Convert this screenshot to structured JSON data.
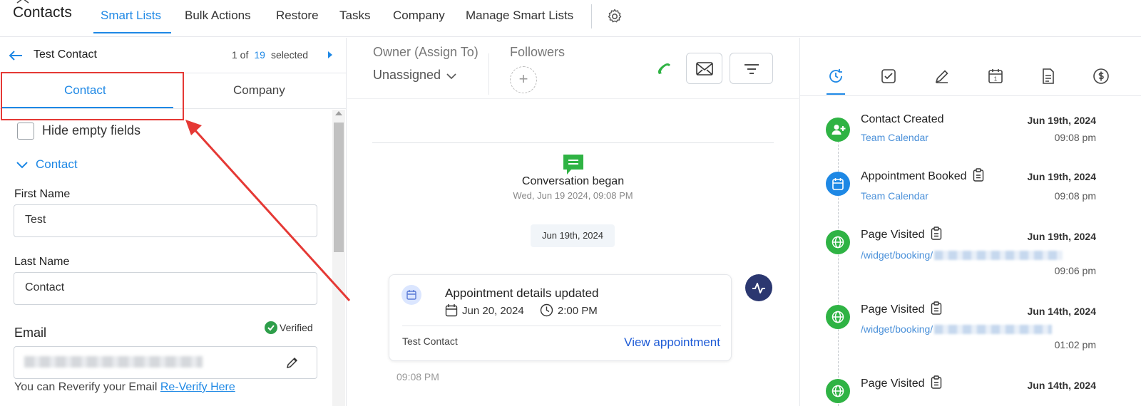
{
  "topnav": {
    "title": "Contacts",
    "items": [
      "Smart Lists",
      "Bulk Actions",
      "Restore",
      "Tasks",
      "Company",
      "Manage Smart Lists"
    ],
    "active_item": "Smart Lists"
  },
  "contact_header": {
    "name": "Test Contact",
    "pager_prefix": "1 of",
    "pager_total": "19",
    "pager_suffix": "selected"
  },
  "left_tabs": [
    "Contact",
    "Company"
  ],
  "form": {
    "hide_empty_label": "Hide empty fields",
    "section_label": "Contact",
    "first_name_label": "First Name",
    "first_name_value": "Test",
    "last_name_label": "Last Name",
    "last_name_value": "Contact",
    "email_label": "Email",
    "verified_label": "Verified",
    "reverify_text": "You can Reverify your Email",
    "reverify_link": "Re-Verify Here"
  },
  "assignment": {
    "owner_label": "Owner (Assign To)",
    "owner_value": "Unassigned",
    "followers_label": "Followers"
  },
  "conversation": {
    "began_title": "Conversation began",
    "began_time": "Wed, Jun 19 2024, 09:08 PM",
    "date_chip": "Jun 19th, 2024",
    "card": {
      "title": "Appointment details updated",
      "date": "Jun 20, 2024",
      "time": "2:00 PM",
      "contact": "Test Contact",
      "link": "View appointment"
    },
    "timestamp": "09:08 PM"
  },
  "timeline": [
    {
      "title": "Contact Created",
      "sub": "Team Calendar",
      "date": "Jun 19th, 2024",
      "time": "09:08 pm",
      "color": "#2fb344"
    },
    {
      "title": "Appointment Booked",
      "sub": "Team Calendar",
      "date": "Jun 19th, 2024",
      "time": "09:08 pm",
      "color": "#1e88e5"
    },
    {
      "title": "Page Visited",
      "sub": "/widget/booking/",
      "date": "Jun 19th, 2024",
      "time": "09:06 pm",
      "color": "#2fb344"
    },
    {
      "title": "Page Visited",
      "sub": "/widget/booking/",
      "date": "Jun 14th, 2024",
      "time": "01:02 pm",
      "color": "#2fb344"
    },
    {
      "title": "Page Visited",
      "sub": "",
      "date": "Jun 14th, 2024",
      "time": "",
      "color": "#2fb344"
    }
  ],
  "colors": {
    "accent": "#1e88e5",
    "highlight": "#e53935",
    "success": "#2e9e4a"
  }
}
